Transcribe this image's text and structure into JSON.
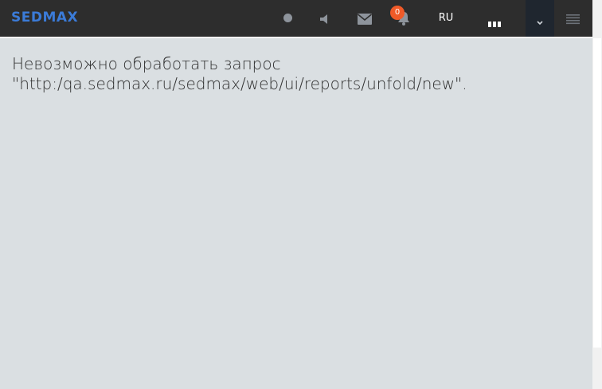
{
  "header": {
    "logo_text": "SEDMAX",
    "notification_count": "0",
    "language": "RU",
    "icons": [
      "status-dot-icon",
      "sound-icon",
      "mail-icon",
      "bell-icon",
      "more-dots-icon",
      "chevron-down-icon",
      "hamburger-menu-icon"
    ],
    "colors": {
      "bar_background": "#2d2d2d",
      "logo": "#3b7bd8",
      "badge": "#f05a28",
      "icon": "#8e949c",
      "dropdown_background": "#1f262f"
    }
  },
  "main": {
    "error_line_1": "Невозможно обработать запрос",
    "error_line_2": "\"http:/qa.sedmax.ru/sedmax/web/ui/reports/unfold/new\".",
    "background_color": "#dadfe2"
  }
}
